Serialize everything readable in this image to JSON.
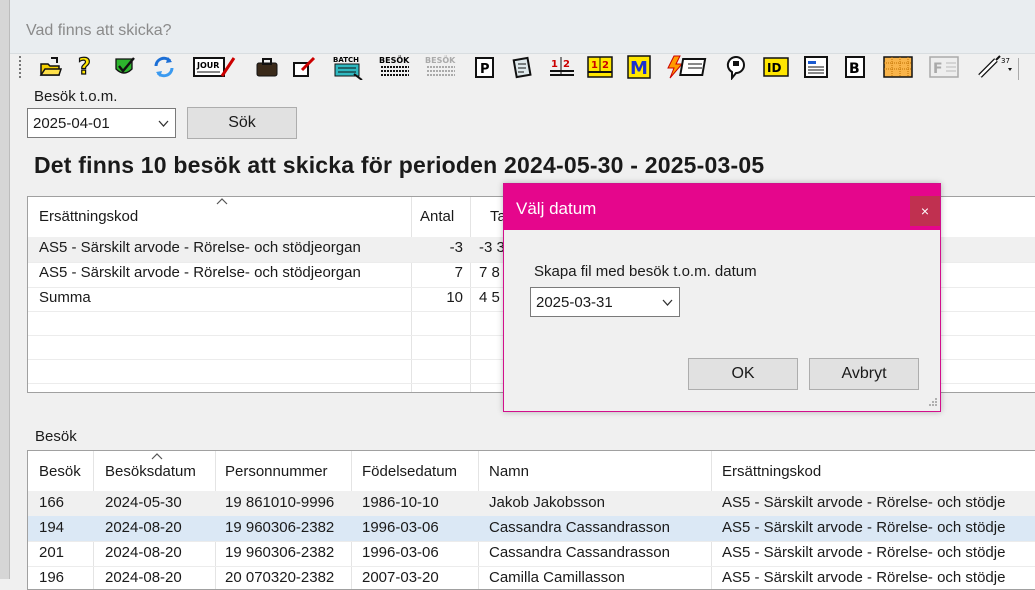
{
  "window": {
    "title": "Vad finns att skicka?"
  },
  "toolbar": {
    "icons": [
      {
        "name": "open-folder-icon",
        "glyph": "📂"
      },
      {
        "name": "help-icon",
        "glyph": "?"
      },
      {
        "name": "checkmark-shield-icon",
        "glyph": "✔"
      },
      {
        "name": "refresh-icon",
        "glyph": "↻"
      },
      {
        "name": "journal-edit-icon",
        "glyph": "JOUR"
      },
      {
        "name": "briefcase-icon",
        "glyph": "💼"
      },
      {
        "name": "edit-checkbox-icon",
        "glyph": "☑"
      },
      {
        "name": "batch-icon",
        "glyph": "BATCH"
      },
      {
        "name": "besok-icon",
        "glyph": "BESÖK"
      },
      {
        "name": "besok-disabled-icon",
        "glyph": "BESÖK"
      },
      {
        "name": "p-document-icon",
        "glyph": "P"
      },
      {
        "name": "notes-icon",
        "glyph": "✎"
      },
      {
        "name": "calendar-12-icon",
        "glyph": "1|2"
      },
      {
        "name": "calendar-12-yellow-icon",
        "glyph": "1|2"
      },
      {
        "name": "m-icon",
        "glyph": "M"
      },
      {
        "name": "lightning-card-icon",
        "glyph": "⚡"
      },
      {
        "name": "speech-icon",
        "glyph": "💬"
      },
      {
        "name": "id-icon",
        "glyph": "ID"
      },
      {
        "name": "form-icon",
        "glyph": "▤"
      },
      {
        "name": "b-document-icon",
        "glyph": "B"
      },
      {
        "name": "orange-grid-icon",
        "glyph": "▦"
      },
      {
        "name": "f-disabled-icon",
        "glyph": "F"
      },
      {
        "name": "syringe-icon",
        "glyph": "💉"
      }
    ]
  },
  "filter": {
    "label": "Besök t.o.m.",
    "date_value": "2025-04-01",
    "search_button": "Sök"
  },
  "heading": "Det finns 10 besök att skicka för perioden 2024-05-30 - 2025-03-05",
  "summary_table": {
    "headers": [
      "Ersättningskod",
      "Antal",
      "Ta"
    ],
    "rows": [
      [
        "AS5 - Särskilt arvode - Rörelse- och stödjeorgan",
        "-3",
        "-3 3"
      ],
      [
        "AS5 - Särskilt arvode - Rörelse- och stödjeorgan",
        "7",
        "7 8"
      ],
      [
        "Summa",
        "10",
        "4 5"
      ]
    ]
  },
  "visits_section": {
    "label": "Besök"
  },
  "visits_table": {
    "headers": [
      "Besök",
      "Besöksdatum",
      "Personnummer",
      "Födelsedatum",
      "Namn",
      "Ersättningskod"
    ],
    "rows": [
      [
        "166",
        "2024-05-30",
        "19 861010-9996",
        "1986-10-10",
        "Jakob Jakobsson",
        "AS5 - Särskilt arvode - Rörelse- och stödje"
      ],
      [
        "194",
        "2024-08-20",
        "19 960306-2382",
        "1996-03-06",
        "Cassandra Cassandrasson",
        "AS5 - Särskilt arvode - Rörelse- och stödje"
      ],
      [
        "201",
        "2024-08-20",
        "19 960306-2382",
        "1996-03-06",
        "Cassandra Cassandrasson",
        "AS5 - Särskilt arvode - Rörelse- och stödje"
      ],
      [
        "196",
        "2024-08-20",
        "20 070320-2382",
        "2007-03-20",
        "Camilla Camillasson",
        "AS5 - Särskilt arvode - Rörelse- och stödje"
      ]
    ]
  },
  "dialog": {
    "title": "Välj datum",
    "close_glyph": "×",
    "prompt": "Skapa fil med besök t.o.m. datum",
    "date_value": "2025-03-31",
    "ok_button": "OK",
    "cancel_button": "Avbryt"
  },
  "colors": {
    "dialog_accent": "#e5068c",
    "selected_row": "#dbe8f5"
  }
}
